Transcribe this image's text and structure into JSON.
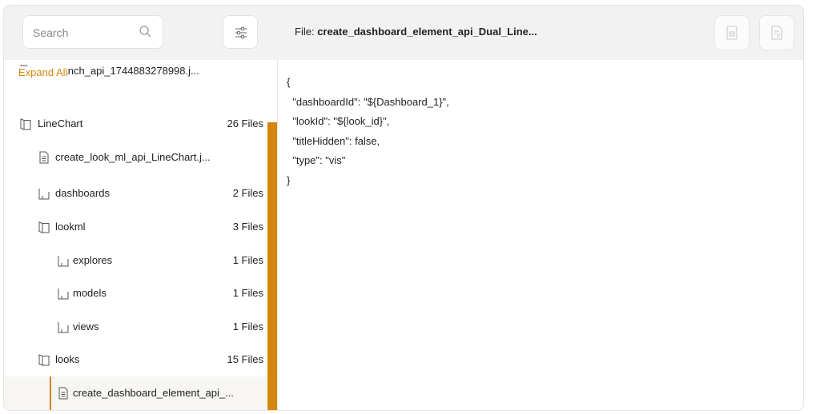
{
  "search": {
    "placeholder": "Search"
  },
  "file": {
    "prefix": "File:",
    "name": "create_dashboard_element_api_Dual_Line..."
  },
  "tree": {
    "expand_all": "Expand All",
    "items": [
      {
        "label": "git_branch_api_1744883278998.j...",
        "count": "",
        "type": "file"
      },
      {
        "label": "LineChart",
        "count": "26 Files",
        "type": "folder-open"
      },
      {
        "label": "create_look_ml_api_LineChart.j...",
        "count": "",
        "type": "file"
      },
      {
        "label": "dashboards",
        "count": "2 Files",
        "type": "folder"
      },
      {
        "label": "lookml",
        "count": "3 Files",
        "type": "folder-open"
      },
      {
        "label": "explores",
        "count": "1 Files",
        "type": "folder"
      },
      {
        "label": "models",
        "count": "1 Files",
        "type": "folder"
      },
      {
        "label": "views",
        "count": "1 Files",
        "type": "folder"
      },
      {
        "label": "looks",
        "count": "15 Files",
        "type": "folder-open"
      },
      {
        "label": "create_dashboard_element_api_...",
        "count": "",
        "type": "file"
      }
    ]
  },
  "code_lines": [
    "{",
    "  \"dashboardId\": \"${Dashboard_1}\",",
    "  \"lookId\": \"${look_id}\",",
    "  \"titleHidden\": false,",
    "  \"type\": \"vis\"",
    "}"
  ],
  "colors": {
    "accent": "#d4870c",
    "bar_bg": "#f2f2f2"
  },
  "icons": {
    "search": "search-icon",
    "filter": "sliders-icon",
    "action1": "document-icon",
    "action2": "edit-document-icon",
    "file": "file-icon",
    "folder": "folder-icon",
    "folder_open": "folder-open-icon"
  }
}
